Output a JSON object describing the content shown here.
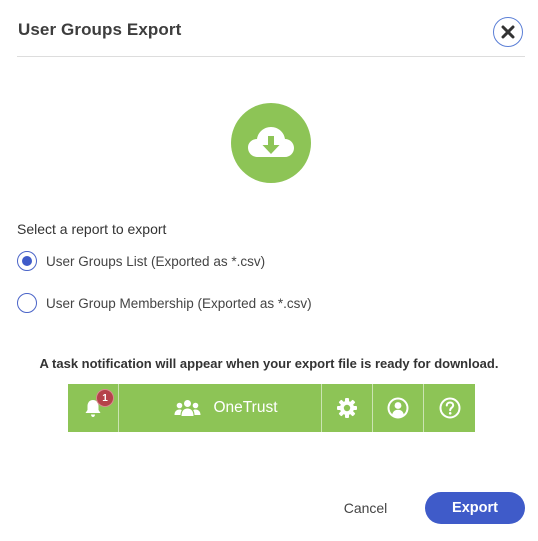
{
  "dialog": {
    "title": "User Groups Export",
    "close_icon": "close-icon"
  },
  "hero": {
    "icon": "cloud-download-icon",
    "color": "#8dc456"
  },
  "report": {
    "prompt": "Select a report to export",
    "options": [
      {
        "label": "User Groups List (Exported as *.csv)",
        "selected": true
      },
      {
        "label": "User Group Membership (Exported as *.csv)",
        "selected": false
      }
    ]
  },
  "notice": "A task notification will appear when your export file is ready for download.",
  "preview_bar": {
    "notification_count": "1",
    "brand": "OneTrust",
    "icons": [
      "bell-icon",
      "users-icon",
      "gear-icon",
      "user-circle-icon",
      "help-icon"
    ],
    "color": "#8dc456"
  },
  "footer": {
    "cancel_label": "Cancel",
    "export_label": "Export",
    "accent": "#3f5bc9"
  }
}
